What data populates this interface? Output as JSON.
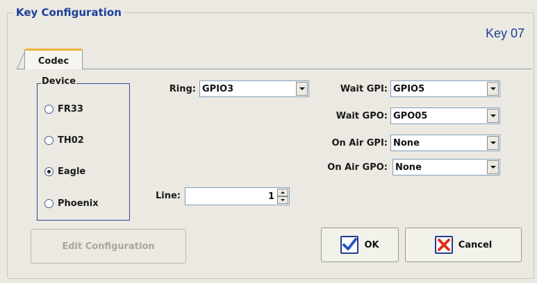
{
  "group": {
    "title": "Key Configuration",
    "key_label": "Key 07"
  },
  "tab": {
    "label": "Codec"
  },
  "device": {
    "title": "Device",
    "options": [
      "FR33",
      "TH02",
      "Eagle",
      "Phoenix"
    ],
    "selected": "Eagle"
  },
  "ring": {
    "label": "Ring:",
    "value": "GPIO3"
  },
  "line": {
    "label": "Line:",
    "value": "1"
  },
  "wait_gpi": {
    "label": "Wait GPI:",
    "value": "GPIO5"
  },
  "wait_gpo": {
    "label": "Wait GPO:",
    "value": "GPO05"
  },
  "on_air_gpi": {
    "label": "On Air GPI:",
    "value": "None"
  },
  "on_air_gpo": {
    "label": "On Air GPO:",
    "value": "None"
  },
  "buttons": {
    "edit_configuration": "Edit Configuration",
    "ok": "OK",
    "cancel": "Cancel"
  },
  "colors": {
    "accent": "#1c3f9a",
    "ok_check": "#2a55c9",
    "cancel_x": "#e0321b"
  }
}
